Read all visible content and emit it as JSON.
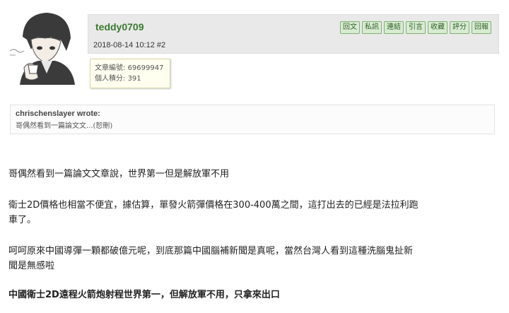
{
  "post": {
    "username": "teddy0709",
    "date": "2018-08-14 10:12",
    "floor": "#2",
    "actions": [
      "回文",
      "私訊",
      "連結",
      "引言",
      "收藏",
      "評分",
      "回報"
    ],
    "stats": {
      "article_label": "文章編號:",
      "article_id": "69699947",
      "score_label": "個人積分:",
      "score": "391"
    }
  },
  "quote": {
    "author": "chrischenslayer wrote:",
    "text": "哥偶然看到一篇論文文...(恕刪)"
  },
  "body": {
    "p1": "哥偶然看到一篇論文文章說，世界第一但是解放軍不用",
    "p2a": "衛士2D價格也相當不便宜，據估算，單發火箭彈價格在300-400萬之間，這打出去的已經是法拉利跑",
    "p2b": "車了。",
    "p3a": "呵呵原來中國導彈一顆都破億元呢，到底那篇中國腦補新聞是真呢，當然台灣人看到這種洗腦鬼扯新",
    "p3b": "聞是無感啦",
    "p4": "中國衛士2D遠程火箭炮射程世界第一，但解放軍不用，只拿來出口"
  }
}
